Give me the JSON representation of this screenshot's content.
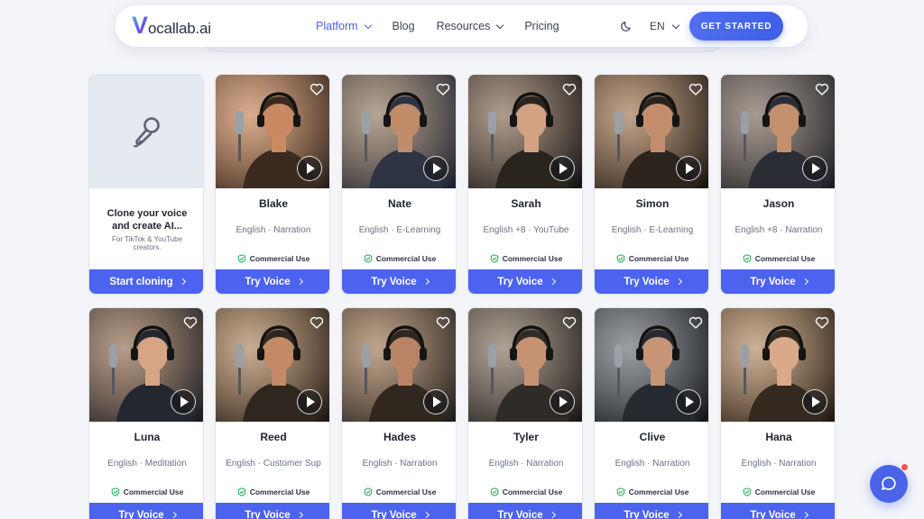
{
  "nav": {
    "logo_letter": "V",
    "logo_text": "ocallab.ai",
    "links": [
      {
        "label": "Platform",
        "has_dropdown": true,
        "active": true
      },
      {
        "label": "Blog",
        "has_dropdown": false,
        "active": false
      },
      {
        "label": "Resources",
        "has_dropdown": true,
        "active": false
      },
      {
        "label": "Pricing",
        "has_dropdown": false,
        "active": false
      }
    ],
    "theme_icon": "moon-icon",
    "language": "EN",
    "cta_label": "GET STARTED"
  },
  "clone_card": {
    "icon": "microphone-icon",
    "title": "Clone your voice and create AI...",
    "subtitle": "For TikTok & YouTube creators.",
    "button_label": "Start cloning"
  },
  "voices": [
    {
      "name": "Blake",
      "tags": "English · Narration",
      "badge": "Commercial Use",
      "button": "Try Voice"
    },
    {
      "name": "Nate",
      "tags": "English · E-Learning",
      "badge": "Commercial Use",
      "button": "Try Voice"
    },
    {
      "name": "Sarah",
      "tags": "English +8 · YouTube",
      "badge": "Commercial Use",
      "button": "Try Voice"
    },
    {
      "name": "Simon",
      "tags": "English · E-Learning",
      "badge": "Commercial Use",
      "button": "Try Voice"
    },
    {
      "name": "Jason",
      "tags": "English +8 · Narration",
      "badge": "Commercial Use",
      "button": "Try Voice"
    },
    {
      "name": "Luna",
      "tags": "English · Meditation",
      "badge": "Commercial Use",
      "button": "Try Voice"
    },
    {
      "name": "Reed",
      "tags": "English · Customer Sup",
      "badge": "Commercial Use",
      "button": "Try Voice"
    },
    {
      "name": "Hades",
      "tags": "English · Narration",
      "badge": "Commercial Use",
      "button": "Try Voice"
    },
    {
      "name": "Tyler",
      "tags": "English · Narration",
      "badge": "Commercial Use",
      "button": "Try Voice"
    },
    {
      "name": "Clive",
      "tags": "English · Narration",
      "badge": "Commercial Use",
      "button": "Try Voice"
    },
    {
      "name": "Hana",
      "tags": "English · Narration",
      "badge": "Commercial Use",
      "button": "Try Voice"
    }
  ],
  "colors": {
    "accent": "#4b63ef",
    "background": "#f3f5f8",
    "badge_green": "#22a55a"
  },
  "chat_widget": {
    "icon": "chat-bubble-icon",
    "has_notification": true
  }
}
